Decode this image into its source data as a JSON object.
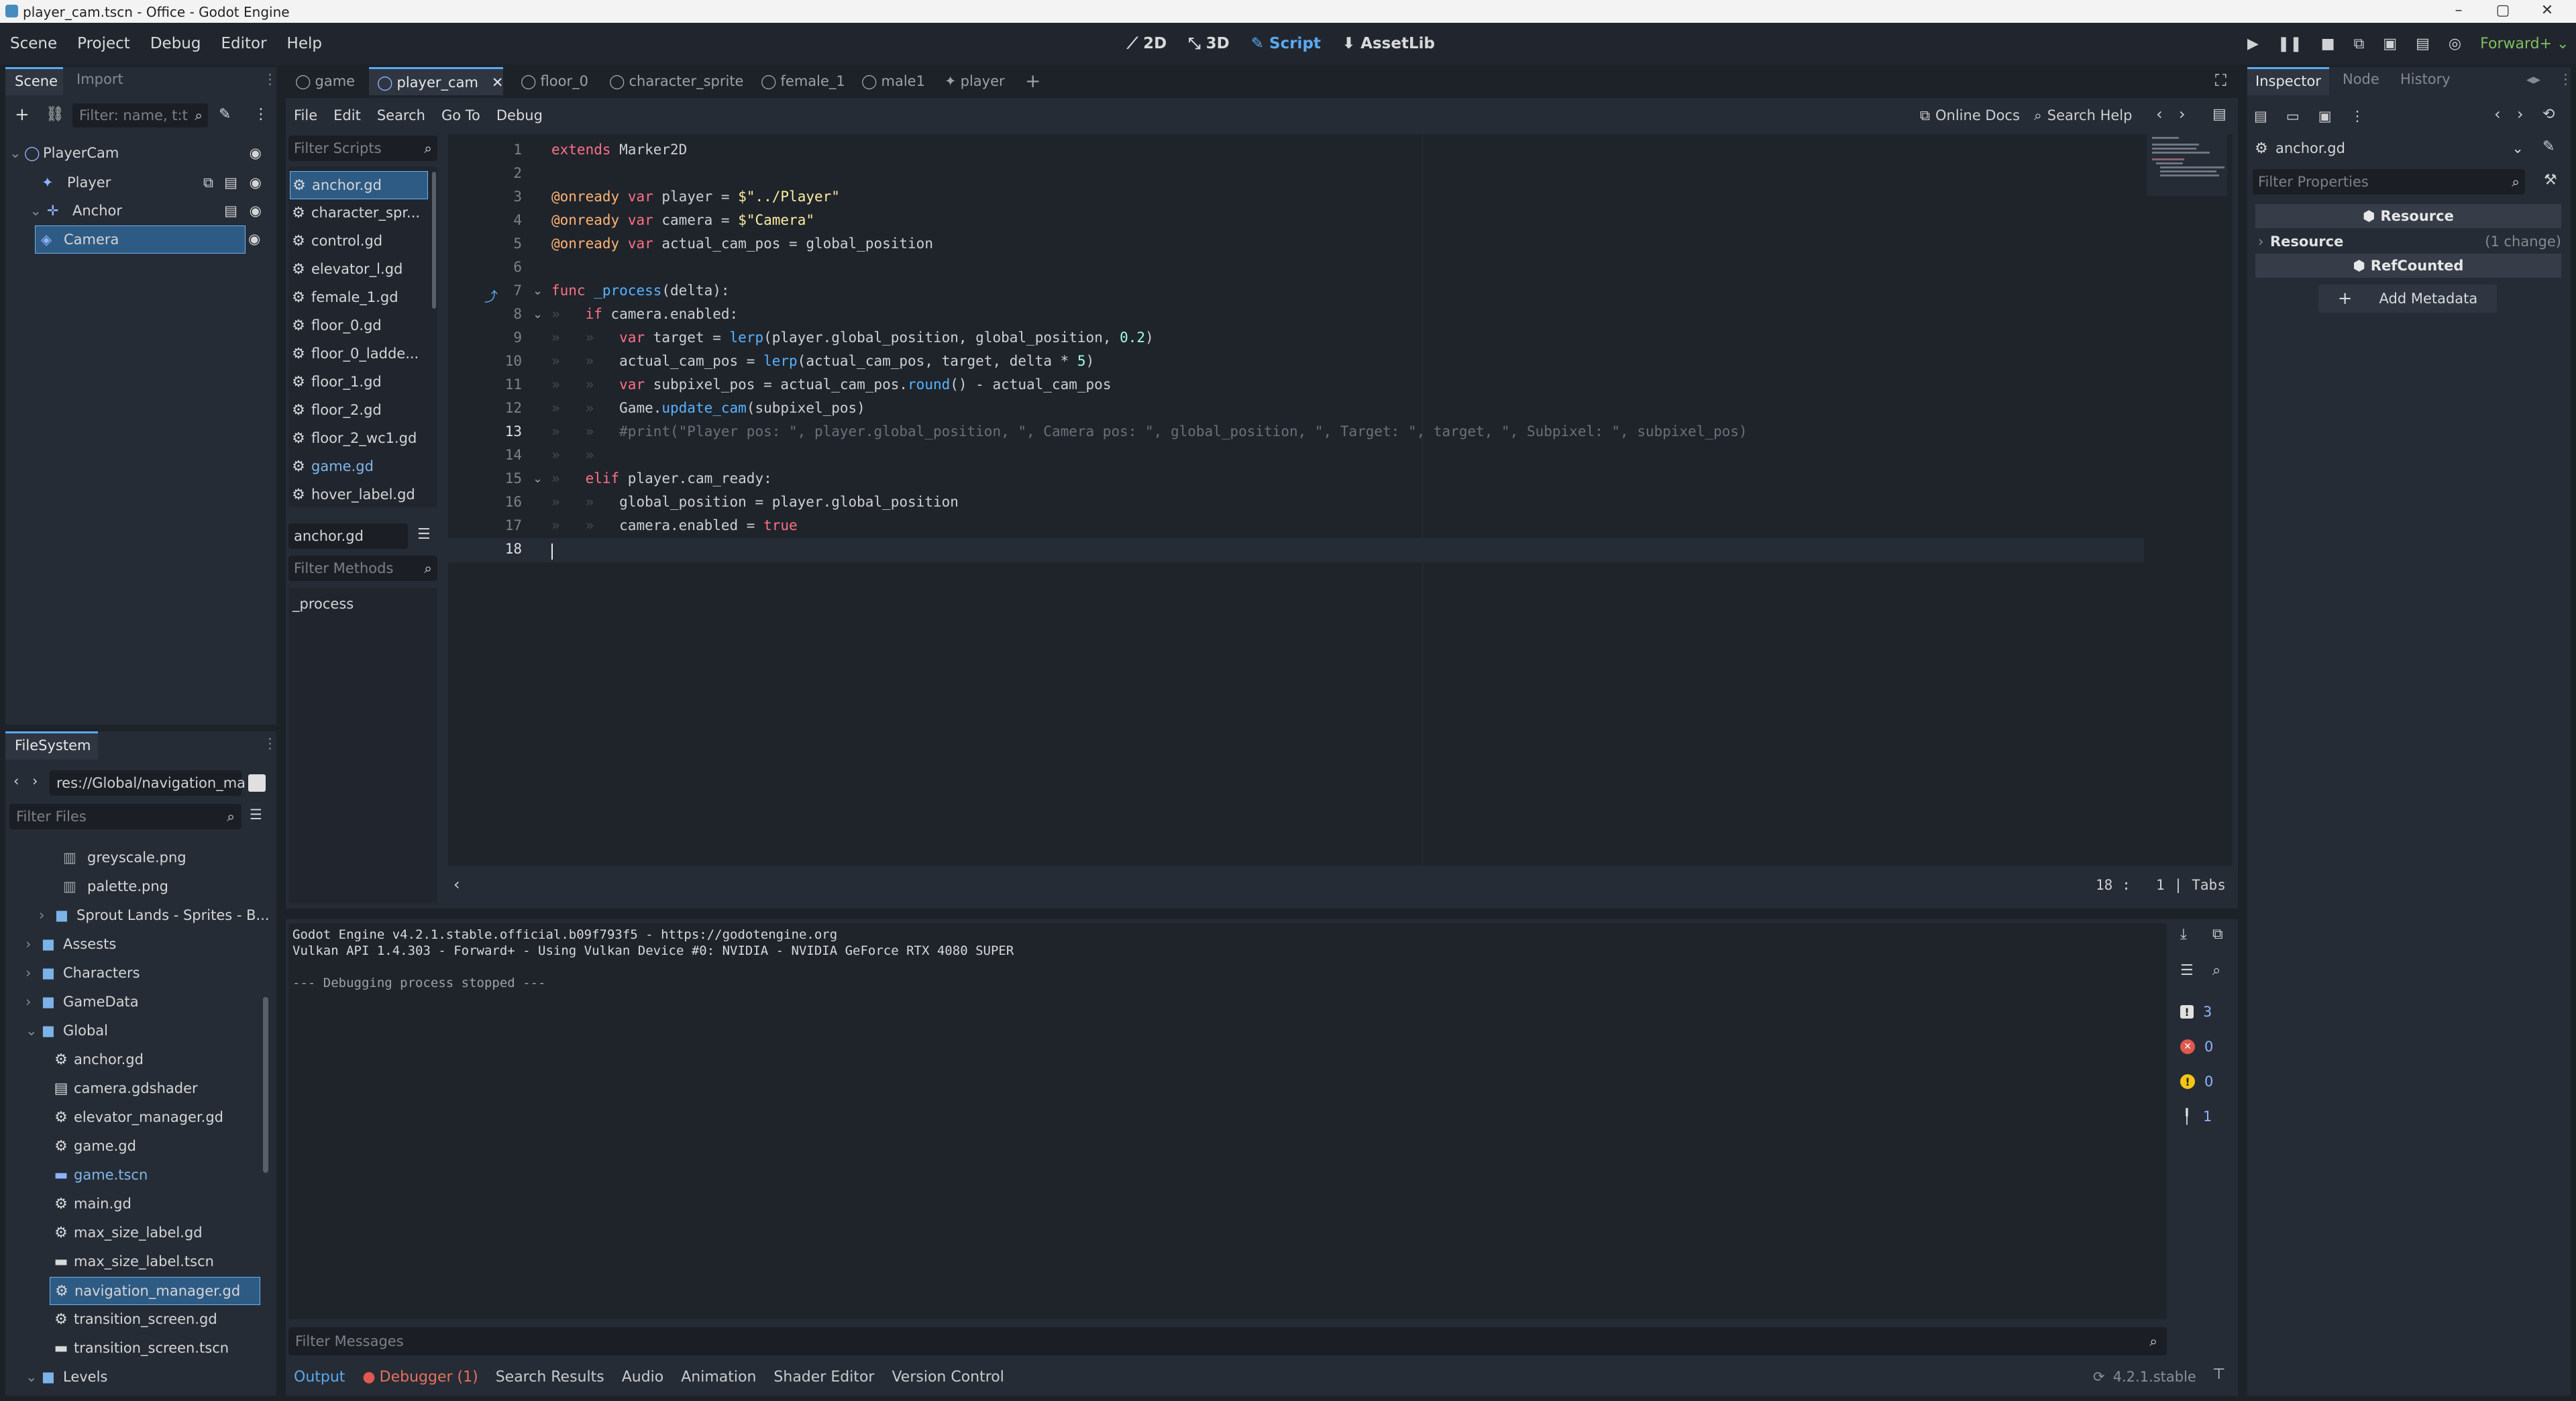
{
  "window": {
    "title": "player_cam.tscn - Office - Godot Engine",
    "controls": {
      "minimize": "–",
      "maximize": "▢",
      "close": "✕"
    }
  },
  "menubar": {
    "items": [
      "Scene",
      "Project",
      "Debug",
      "Editor",
      "Help"
    ],
    "workspaces": [
      "2D",
      "3D",
      "Script",
      "AssetLib"
    ],
    "active_workspace": "Script",
    "renderer": "Forward+"
  },
  "scene_dock": {
    "tabs": [
      "Scene",
      "Import"
    ],
    "filter_placeholder": "Filter: name, t:t",
    "tree": [
      "PlayerCam",
      "Player",
      "Anchor",
      "Camera"
    ],
    "selected": "Camera"
  },
  "filesystem": {
    "title": "FileSystem",
    "path": "res://Global/navigation_ma",
    "filter_placeholder": "Filter Files",
    "items": [
      {
        "name": "greyscale.png",
        "type": "image"
      },
      {
        "name": "palette.png",
        "type": "image"
      },
      {
        "name": "Sprout Lands - Sprites - B...",
        "type": "folder"
      },
      {
        "name": "Assests",
        "type": "folder"
      },
      {
        "name": "Characters",
        "type": "folder"
      },
      {
        "name": "GameData",
        "type": "folder"
      },
      {
        "name": "Global",
        "type": "folder-open"
      },
      {
        "name": "anchor.gd",
        "type": "script"
      },
      {
        "name": "camera.gdshader",
        "type": "shader"
      },
      {
        "name": "elevator_manager.gd",
        "type": "script"
      },
      {
        "name": "game.gd",
        "type": "script"
      },
      {
        "name": "game.tscn",
        "type": "scene"
      },
      {
        "name": "main.gd",
        "type": "script"
      },
      {
        "name": "max_size_label.gd",
        "type": "script"
      },
      {
        "name": "max_size_label.tscn",
        "type": "scene"
      },
      {
        "name": "navigation_manager.gd",
        "type": "script",
        "selected": true
      },
      {
        "name": "transition_screen.gd",
        "type": "script"
      },
      {
        "name": "transition_screen.tscn",
        "type": "scene"
      },
      {
        "name": "Levels",
        "type": "folder-open"
      }
    ]
  },
  "scene_tabs": [
    "game",
    "player_cam",
    "floor_0",
    "character_sprite",
    "female_1",
    "male1",
    "player"
  ],
  "active_scene_tab": "player_cam",
  "script_menu": [
    "File",
    "Edit",
    "Search",
    "Go To",
    "Debug"
  ],
  "script_toolbar": {
    "online_docs": "Online Docs",
    "search_help": "Search Help"
  },
  "script_list": {
    "filter_placeholder": "Filter Scripts",
    "items": [
      "anchor.gd",
      "character_spr...",
      "control.gd",
      "elevator_l.gd",
      "female_1.gd",
      "floor_0.gd",
      "floor_0_ladde...",
      "floor_1.gd",
      "floor_2.gd",
      "floor_2_wc1.gd",
      "game.gd",
      "hover_label.gd"
    ],
    "selected": "anchor.gd",
    "current_script": "anchor.gd",
    "methods_placeholder": "Filter Methods",
    "methods": [
      "_process"
    ]
  },
  "code_lines": [
    "extends Marker2D",
    "",
    "@onready var player = $\"../Player\"",
    "@onready var camera = $\"Camera\"",
    "@onready var actual_cam_pos = global_position",
    "",
    "func _process(delta):",
    "if camera.enabled:",
    "var target = lerp(player.global_position, global_position, 0.2)",
    "actual_cam_pos = lerp(actual_cam_pos, target, delta * 5)",
    "var subpixel_pos = actual_cam_pos.round() - actual_cam_pos",
    "Game.update_cam(subpixel_pos)",
    "#print(\"Player pos: \", player.global_position, \", Camera pos: \", global_position, \", Target: \", target, \", Subpixel: \", subpixel_pos)",
    "elif player.cam_ready:",
    "global_position = player.global_position",
    "camera.enabled = true",
    "",
    ""
  ],
  "status": {
    "line": "18",
    "col": "1",
    "indent": "Tabs"
  },
  "output": {
    "lines": [
      "Godot Engine v4.2.1.stable.official.b09f793f5 - https://godotengine.org",
      "Vulkan API 1.4.303 - Forward+ - Using Vulkan Device #0: NVIDIA - NVIDIA GeForce RTX 4080 SUPER",
      "",
      "--- Debugging process stopped ---"
    ],
    "filter_placeholder": "Filter Messages",
    "counts": {
      "messages": "3",
      "errors": "0",
      "warnings": "0",
      "editor": "1"
    }
  },
  "bottom_tabs": [
    "Output",
    "Debugger (1)",
    "Search Results",
    "Audio",
    "Animation",
    "Shader Editor",
    "Version Control"
  ],
  "version": "4.2.1.stable",
  "inspector": {
    "tabs": [
      "Inspector",
      "Node",
      "History"
    ],
    "object": "anchor.gd",
    "filter_placeholder": "Filter Properties",
    "resource_header": "Resource",
    "resource_section": "Resource",
    "resource_changes": "(1 change)",
    "refcounted": "RefCounted",
    "add_metadata": "Add Metadata"
  },
  "colors": {
    "accent": "#5aa9f0",
    "background": "#1d2229",
    "panel": "#262c35",
    "keyword": "#ff7085",
    "string": "#ffeda1",
    "function": "#57b3ff",
    "error": "#e0584f",
    "warning": "#f5c518"
  }
}
